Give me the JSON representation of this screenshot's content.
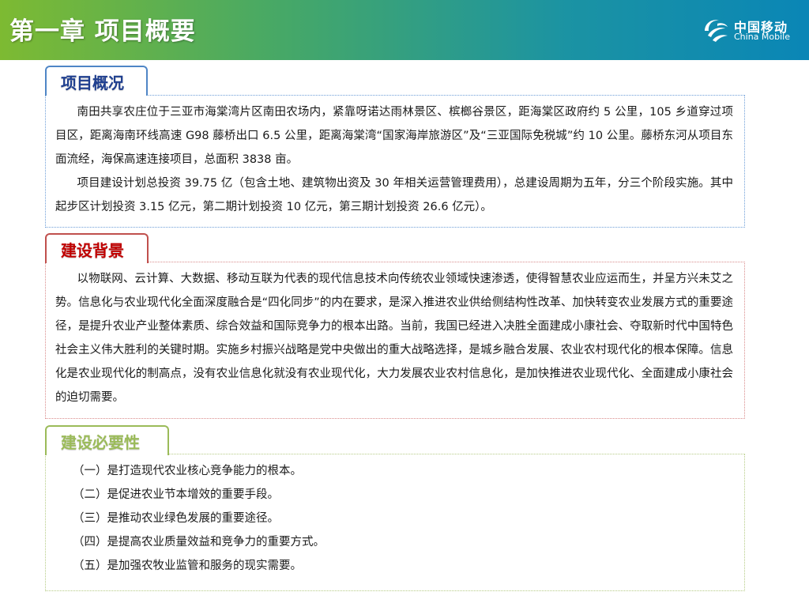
{
  "header": {
    "title": "第一章 项目概要",
    "logo_cn": "中国移动",
    "logo_en": "China Mobile"
  },
  "sections": {
    "overview": {
      "tab_label": "项目概况",
      "paragraphs": [
        "南田共享农庄位于三亚市海棠湾片区南田农场内，紧靠呀诺达雨林景区、槟榔谷景区，距海棠区政府约 5 公里，105 乡道穿过项目区，距离海南环线高速 G98 藤桥出口 6.5 公里，距离海棠湾“国家海岸旅游区”及“三亚国际免税城”约 10 公里。藤桥东河从项目东面流经，海保高速连接项目，总面积 3838 亩。",
        "项目建设计划总投资 39.75 亿（包含土地、建筑物出资及 30 年相关运营管理费用），总建设周期为五年，分三个阶段实施。其中起步区计划投资 3.15 亿元，第二期计划投资 10 亿元，第三期计划投资 26.6 亿元）。"
      ]
    },
    "background": {
      "tab_label": "建设背景",
      "paragraphs": [
        "以物联网、云计算、大数据、移动互联为代表的现代信息技术向传统农业领域快速渗透，使得智慧农业应运而生，并呈方兴未艾之势。信息化与农业现代化全面深度融合是“四化同步”的内在要求，是深入推进农业供给侧结构性改革、加快转变农业发展方式的重要途径，是提升农业产业整体素质、综合效益和国际竞争力的根本出路。当前，我国已经进入决胜全面建成小康社会、夺取新时代中国特色社会主义伟大胜利的关键时期。实施乡村振兴战略是党中央做出的重大战略选择，是城乡融合发展、农业农村现代化的根本保障。信息化是农业现代化的制高点，没有农业信息化就没有农业现代化，大力发展农业农村信息化，是加快推进农业现代化、全面建成小康社会的迫切需要。"
      ]
    },
    "necessity": {
      "tab_label": "建设必要性",
      "items": [
        "（一）是打造现代农业核心竞争能力的根本。",
        "（二）是促进农业节本增效的重要手段。",
        "（三）是推动农业绿色发展的重要途径。",
        "（四）是提高农业质量效益和竞争力的重要方式。",
        "（五）是加强农牧业监管和服务的现实需要。"
      ]
    }
  },
  "colors": {
    "overview_accent": "#4f86c6",
    "background_accent": "#c0504d",
    "necessity_accent": "#9bbb59"
  }
}
